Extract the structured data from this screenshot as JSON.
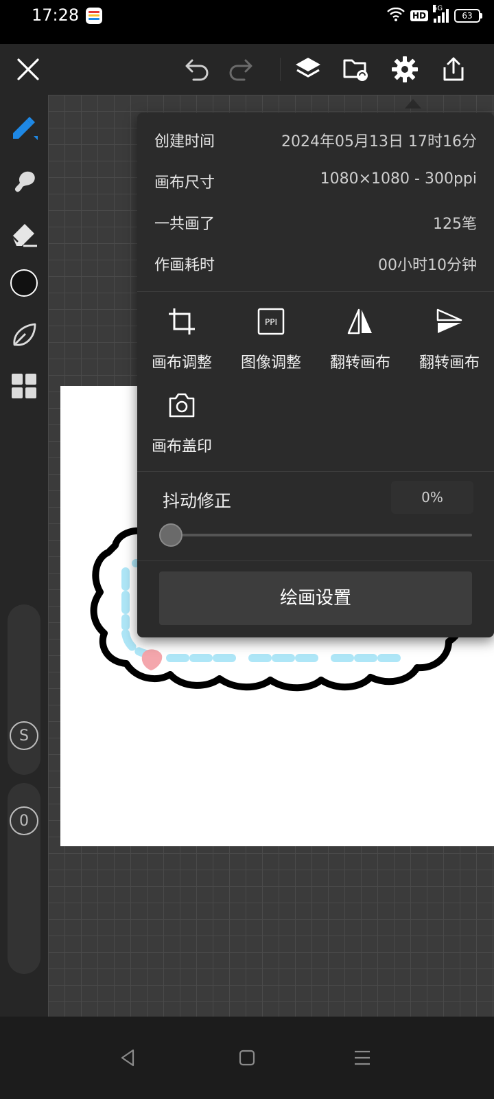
{
  "status_bar": {
    "time": "17:28",
    "hd": "HD",
    "network": "5G",
    "battery": "63",
    "icons": [
      "app-icon",
      "wifi-icon",
      "signal-icon",
      "battery-icon"
    ]
  },
  "top_bar": {
    "icons": [
      "close-icon",
      "undo-icon",
      "redo-icon",
      "layers-icon",
      "import-icon",
      "settings-icon",
      "share-icon"
    ]
  },
  "left_toolbar": {
    "tools": [
      "brush-tool-icon",
      "smudge-tool-icon",
      "eraser-tool-icon",
      "color-swatch",
      "leaf-tool-icon",
      "grid-tool-icon"
    ],
    "current_color": "#111111",
    "accent_color": "#1e88e5",
    "size_knob_label": "S",
    "opacity_knob_label": "0"
  },
  "settings_popup": {
    "info": [
      {
        "label": "创建时间",
        "value": "2024年05月13日 17时16分"
      },
      {
        "label": "画布尺寸",
        "value": "1080×1080 - 300ppi"
      },
      {
        "label": "一共画了",
        "value": "125笔"
      },
      {
        "label": "作画耗时",
        "value": "00小时10分钟"
      }
    ],
    "actions": [
      {
        "label": "画布调整",
        "icon": "crop-icon"
      },
      {
        "label": "图像调整",
        "icon": "ppi-icon",
        "icon_text": "PPI"
      },
      {
        "label": "翻转画布",
        "icon": "flip-horizontal-icon"
      },
      {
        "label": "翻转画布",
        "icon": "flip-vertical-icon"
      },
      {
        "label": "画布盖印",
        "icon": "camera-icon"
      }
    ],
    "stabilizer": {
      "label": "抖动修正",
      "value_text": "0%",
      "value": 0
    },
    "paint_settings_button": "绘画设置"
  },
  "nav_bar": {
    "icons": [
      "back-icon",
      "home-icon",
      "menu-icon"
    ]
  }
}
